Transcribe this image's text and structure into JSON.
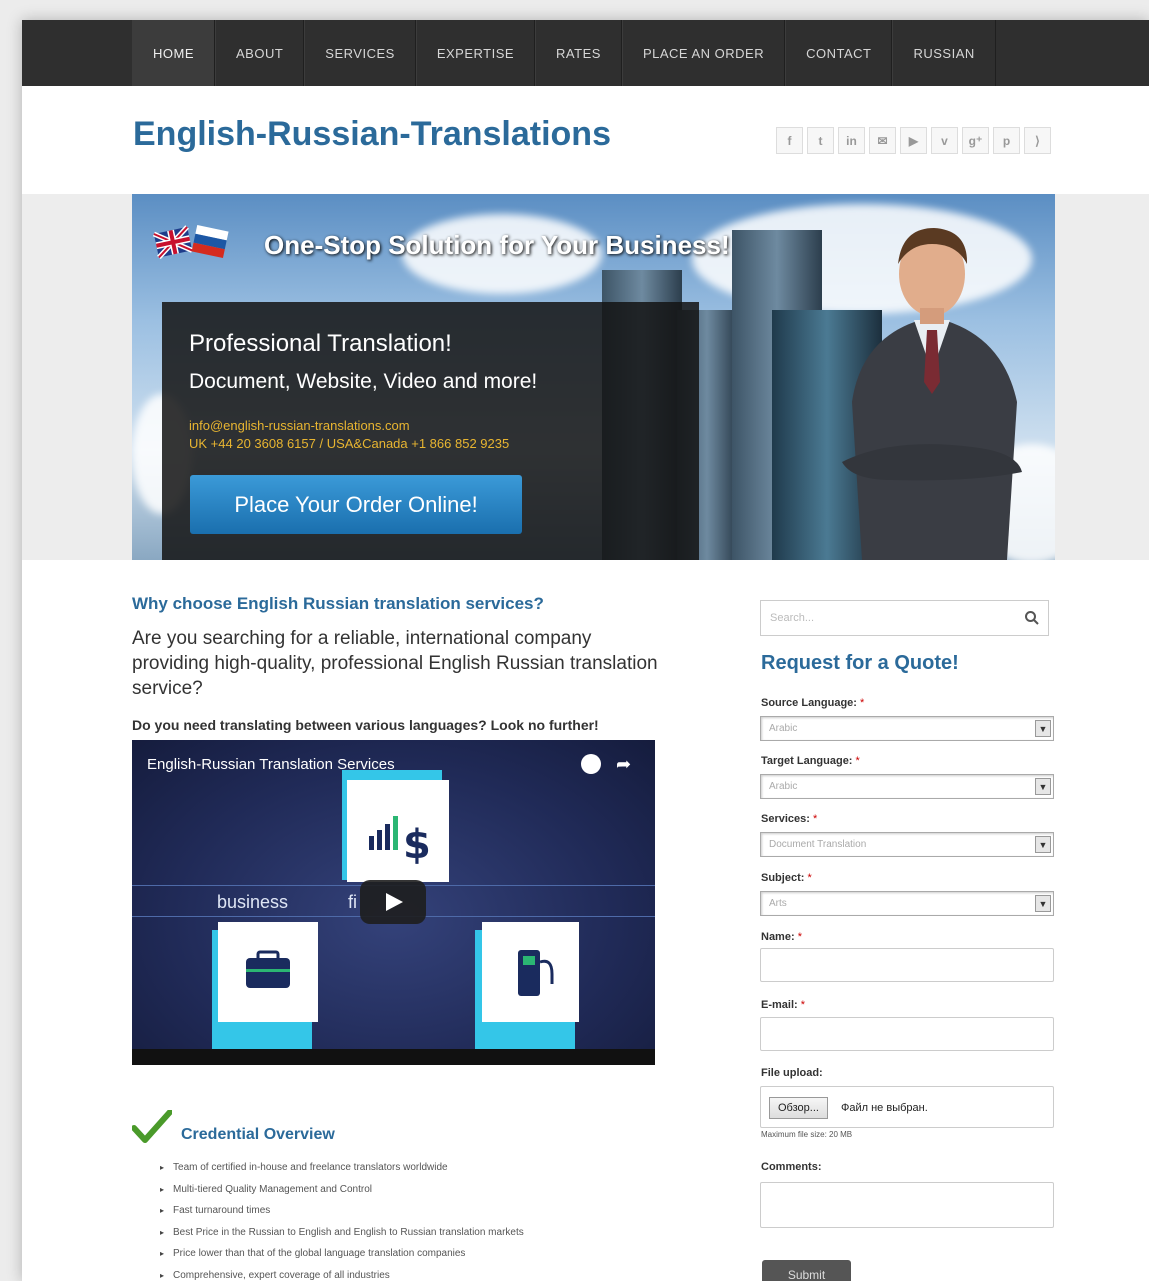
{
  "nav": {
    "items": [
      {
        "label": "HOME"
      },
      {
        "label": "ABOUT"
      },
      {
        "label": "SERVICES"
      },
      {
        "label": "EXPERTISE"
      },
      {
        "label": "RATES"
      },
      {
        "label": "PLACE AN ORDER"
      },
      {
        "label": "CONTACT"
      },
      {
        "label": "RUSSIAN"
      }
    ],
    "active": "HOME"
  },
  "header": {
    "site_title": "English-Russian-Translations",
    "social_icons": [
      {
        "name": "facebook-icon",
        "glyph": "f"
      },
      {
        "name": "twitter-icon",
        "glyph": "t"
      },
      {
        "name": "linkedin-icon",
        "glyph": "in"
      },
      {
        "name": "email-icon",
        "glyph": "✉"
      },
      {
        "name": "youtube-icon",
        "glyph": "▶"
      },
      {
        "name": "vimeo-icon",
        "glyph": "v"
      },
      {
        "name": "google-plus-icon",
        "glyph": "g⁺"
      },
      {
        "name": "pinterest-icon",
        "glyph": "p"
      },
      {
        "name": "rss-icon",
        "glyph": "⟩"
      }
    ]
  },
  "hero": {
    "headline": "One-Stop Solution for Your Business!",
    "pro_title": "Professional Translation!",
    "pro_subtitle": "Document, Website, Video and more!",
    "email": "info@english-russian-translations.com",
    "phones": "UK +44 20 3608 6157 /  USA&Canada +1 866 852 9235",
    "order_button": "Place Your Order Online!"
  },
  "main": {
    "why_heading": "Why choose English Russian translation services?",
    "lead": "Are you searching for a reliable, international company providing high-quality, professional English Russian translation service?",
    "sublead": "Do you need translating between various languages? Look no further!",
    "video": {
      "title": "English-Russian Translation Services",
      "word_business": "business",
      "word_fi": "fi"
    },
    "credential": {
      "title": "Credential Overview",
      "items": [
        "Team of certified in-house and freelance translators worldwide",
        "Multi-tiered Quality Management and Control",
        "Fast turnaround times",
        "Best Price in the Russian to English and English to Russian translation markets",
        "Price lower than that of the global language translation companies",
        "Comprehensive, expert coverage of all industries"
      ]
    }
  },
  "sidebar": {
    "search_placeholder": "Search...",
    "quote_title": "Request for a Quote!",
    "fields": {
      "source_label": "Source Language:",
      "source_value": "Arabic",
      "target_label": "Target Language:",
      "target_value": "Arabic",
      "services_label": "Services:",
      "services_value": "Document Translation",
      "subject_label": "Subject:",
      "subject_value": "Arts",
      "name_label": "Name:",
      "email_label": "E-mail:",
      "file_label": "File upload:",
      "browse_label": "Обзор...",
      "no_file": "Файл не выбран.",
      "max_size": "Maximum file size: 20 MB",
      "comments_label": "Comments:",
      "required_mark": "*"
    },
    "submit_label": "Submit"
  },
  "colors": {
    "accent_blue": "#2b6a9a",
    "nav_bg": "#2f2f2f",
    "contact_gold": "#e8b531",
    "button_blue": "#1a6fae"
  }
}
